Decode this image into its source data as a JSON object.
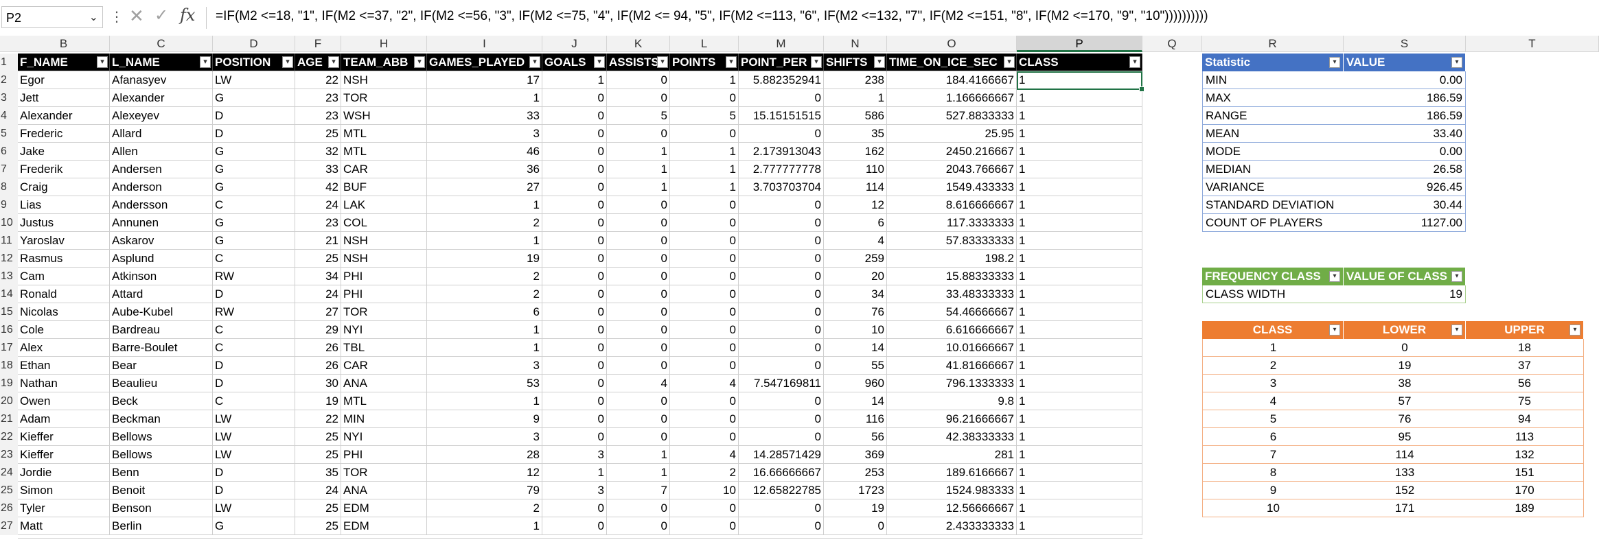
{
  "formula_bar": {
    "name_box": "P2",
    "formula": "=IF(M2 <=18, \"1\", IF(M2 <=37, \"2\", IF(M2 <=56, \"3\", IF(M2 <=75, \"4\", IF(M2 <= 94, \"5\", IF(M2 <=113, \"6\", IF(M2 <=132, \"7\", IF(M2 <=151, \"8\", IF(M2 <=170, \"9\", \"10\"))))))))))"
  },
  "column_letters": [
    "B",
    "C",
    "D",
    "F",
    "H",
    "I",
    "J",
    "K",
    "L",
    "M",
    "N",
    "O",
    "P",
    "Q",
    "R",
    "S",
    "T"
  ],
  "row_numbers": [
    "1",
    "2",
    "3",
    "4",
    "5",
    "6",
    "7",
    "8",
    "9",
    "10",
    "11",
    "12",
    "13",
    "14",
    "15",
    "16",
    "17",
    "18",
    "19",
    "20",
    "21",
    "22",
    "23",
    "24",
    "25",
    "26",
    "27"
  ],
  "main_table": {
    "headers": [
      "F_NAME",
      "L_NAME",
      "POSITION",
      "AGE",
      "TEAM_ABB",
      "GAMES_PLAYED",
      "GOALS",
      "ASSISTS",
      "POINTS",
      "POINT_PER",
      "SHIFTS",
      "TIME_ON_ICE_SEC",
      "CLASS"
    ],
    "rows": [
      [
        "Egor",
        "Afanasyev",
        "LW",
        "22",
        "NSH",
        "17",
        "1",
        "0",
        "1",
        "5.882352941",
        "238",
        "184.4166667",
        "1"
      ],
      [
        "Jett",
        "Alexander",
        "G",
        "23",
        "TOR",
        "1",
        "0",
        "0",
        "0",
        "0",
        "1",
        "1.166666667",
        "1"
      ],
      [
        "Alexander",
        "Alexeyev",
        "D",
        "23",
        "WSH",
        "33",
        "0",
        "5",
        "5",
        "15.15151515",
        "586",
        "527.8833333",
        "1"
      ],
      [
        "Frederic",
        "Allard",
        "D",
        "25",
        "MTL",
        "3",
        "0",
        "0",
        "0",
        "0",
        "35",
        "25.95",
        "1"
      ],
      [
        "Jake",
        "Allen",
        "G",
        "32",
        "MTL",
        "46",
        "0",
        "1",
        "1",
        "2.173913043",
        "162",
        "2450.216667",
        "1"
      ],
      [
        "Frederik",
        "Andersen",
        "G",
        "33",
        "CAR",
        "36",
        "0",
        "1",
        "1",
        "2.777777778",
        "110",
        "2043.766667",
        "1"
      ],
      [
        "Craig",
        "Anderson",
        "G",
        "42",
        "BUF",
        "27",
        "0",
        "1",
        "1",
        "3.703703704",
        "114",
        "1549.433333",
        "1"
      ],
      [
        "Lias",
        "Andersson",
        "C",
        "24",
        "LAK",
        "1",
        "0",
        "0",
        "0",
        "0",
        "12",
        "8.616666667",
        "1"
      ],
      [
        "Justus",
        "Annunen",
        "G",
        "23",
        "COL",
        "2",
        "0",
        "0",
        "0",
        "0",
        "6",
        "117.3333333",
        "1"
      ],
      [
        "Yaroslav",
        "Askarov",
        "G",
        "21",
        "NSH",
        "1",
        "0",
        "0",
        "0",
        "0",
        "4",
        "57.83333333",
        "1"
      ],
      [
        "Rasmus",
        "Asplund",
        "C",
        "25",
        "NSH",
        "19",
        "0",
        "0",
        "0",
        "0",
        "259",
        "198.2",
        "1"
      ],
      [
        "Cam",
        "Atkinson",
        "RW",
        "34",
        "PHI",
        "2",
        "0",
        "0",
        "0",
        "0",
        "20",
        "15.88333333",
        "1"
      ],
      [
        "Ronald",
        "Attard",
        "D",
        "24",
        "PHI",
        "2",
        "0",
        "0",
        "0",
        "0",
        "34",
        "33.48333333",
        "1"
      ],
      [
        "Nicolas",
        "Aube-Kubel",
        "RW",
        "27",
        "TOR",
        "6",
        "0",
        "0",
        "0",
        "0",
        "76",
        "54.46666667",
        "1"
      ],
      [
        "Cole",
        "Bardreau",
        "C",
        "29",
        "NYI",
        "1",
        "0",
        "0",
        "0",
        "0",
        "10",
        "6.616666667",
        "1"
      ],
      [
        "Alex",
        "Barre-Boulet",
        "C",
        "26",
        "TBL",
        "1",
        "0",
        "0",
        "0",
        "0",
        "14",
        "10.01666667",
        "1"
      ],
      [
        "Ethan",
        "Bear",
        "D",
        "26",
        "CAR",
        "3",
        "0",
        "0",
        "0",
        "0",
        "55",
        "41.81666667",
        "1"
      ],
      [
        "Nathan",
        "Beaulieu",
        "D",
        "30",
        "ANA",
        "53",
        "0",
        "4",
        "4",
        "7.547169811",
        "960",
        "796.1333333",
        "1"
      ],
      [
        "Owen",
        "Beck",
        "C",
        "19",
        "MTL",
        "1",
        "0",
        "0",
        "0",
        "0",
        "14",
        "9.8",
        "1"
      ],
      [
        "Adam",
        "Beckman",
        "LW",
        "22",
        "MIN",
        "9",
        "0",
        "0",
        "0",
        "0",
        "116",
        "96.21666667",
        "1"
      ],
      [
        "Kieffer",
        "Bellows",
        "LW",
        "25",
        "NYI",
        "3",
        "0",
        "0",
        "0",
        "0",
        "56",
        "42.38333333",
        "1"
      ],
      [
        "Kieffer",
        "Bellows",
        "LW",
        "25",
        "PHI",
        "28",
        "3",
        "1",
        "4",
        "14.28571429",
        "369",
        "281",
        "1"
      ],
      [
        "Jordie",
        "Benn",
        "D",
        "35",
        "TOR",
        "12",
        "1",
        "1",
        "2",
        "16.66666667",
        "253",
        "189.6166667",
        "1"
      ],
      [
        "Simon",
        "Benoit",
        "D",
        "24",
        "ANA",
        "79",
        "3",
        "7",
        "10",
        "12.65822785",
        "1723",
        "1524.983333",
        "1"
      ],
      [
        "Tyler",
        "Benson",
        "LW",
        "25",
        "EDM",
        "2",
        "0",
        "0",
        "0",
        "0",
        "19",
        "12.56666667",
        "1"
      ],
      [
        "Matt",
        "Berlin",
        "G",
        "25",
        "EDM",
        "1",
        "0",
        "0",
        "0",
        "0",
        "0",
        "2.433333333",
        "1"
      ]
    ]
  },
  "stats_table": {
    "headers": [
      "Statistic",
      "VALUE"
    ],
    "rows": [
      [
        "MIN",
        "0.00"
      ],
      [
        "MAX",
        "186.59"
      ],
      [
        "RANGE",
        "186.59"
      ],
      [
        "MEAN",
        "33.40"
      ],
      [
        "MODE",
        "0.00"
      ],
      [
        "MEDIAN",
        "26.58"
      ],
      [
        "VARIANCE",
        "926.45"
      ],
      [
        "STANDARD DEVIATION",
        "30.44"
      ],
      [
        "COUNT OF PLAYERS",
        "1127.00"
      ]
    ]
  },
  "freq_table": {
    "headers": [
      "FREQUENCY CLASS",
      "VALUE OF CLASS"
    ],
    "rows": [
      [
        "CLASS WIDTH",
        "19"
      ]
    ]
  },
  "class_table": {
    "headers": [
      "CLASS",
      "LOWER",
      "UPPER"
    ],
    "rows": [
      [
        "1",
        "0",
        "18"
      ],
      [
        "2",
        "19",
        "37"
      ],
      [
        "3",
        "38",
        "56"
      ],
      [
        "4",
        "57",
        "75"
      ],
      [
        "5",
        "76",
        "94"
      ],
      [
        "6",
        "95",
        "113"
      ],
      [
        "7",
        "114",
        "132"
      ],
      [
        "8",
        "133",
        "151"
      ],
      [
        "9",
        "152",
        "170"
      ],
      [
        "10",
        "171",
        "189"
      ]
    ]
  },
  "colors": {
    "header_black": "#000000",
    "stats_blue": "#4472c4",
    "freq_green": "#70ad47",
    "class_orange": "#ed7d31",
    "selection_green": "#217346"
  }
}
